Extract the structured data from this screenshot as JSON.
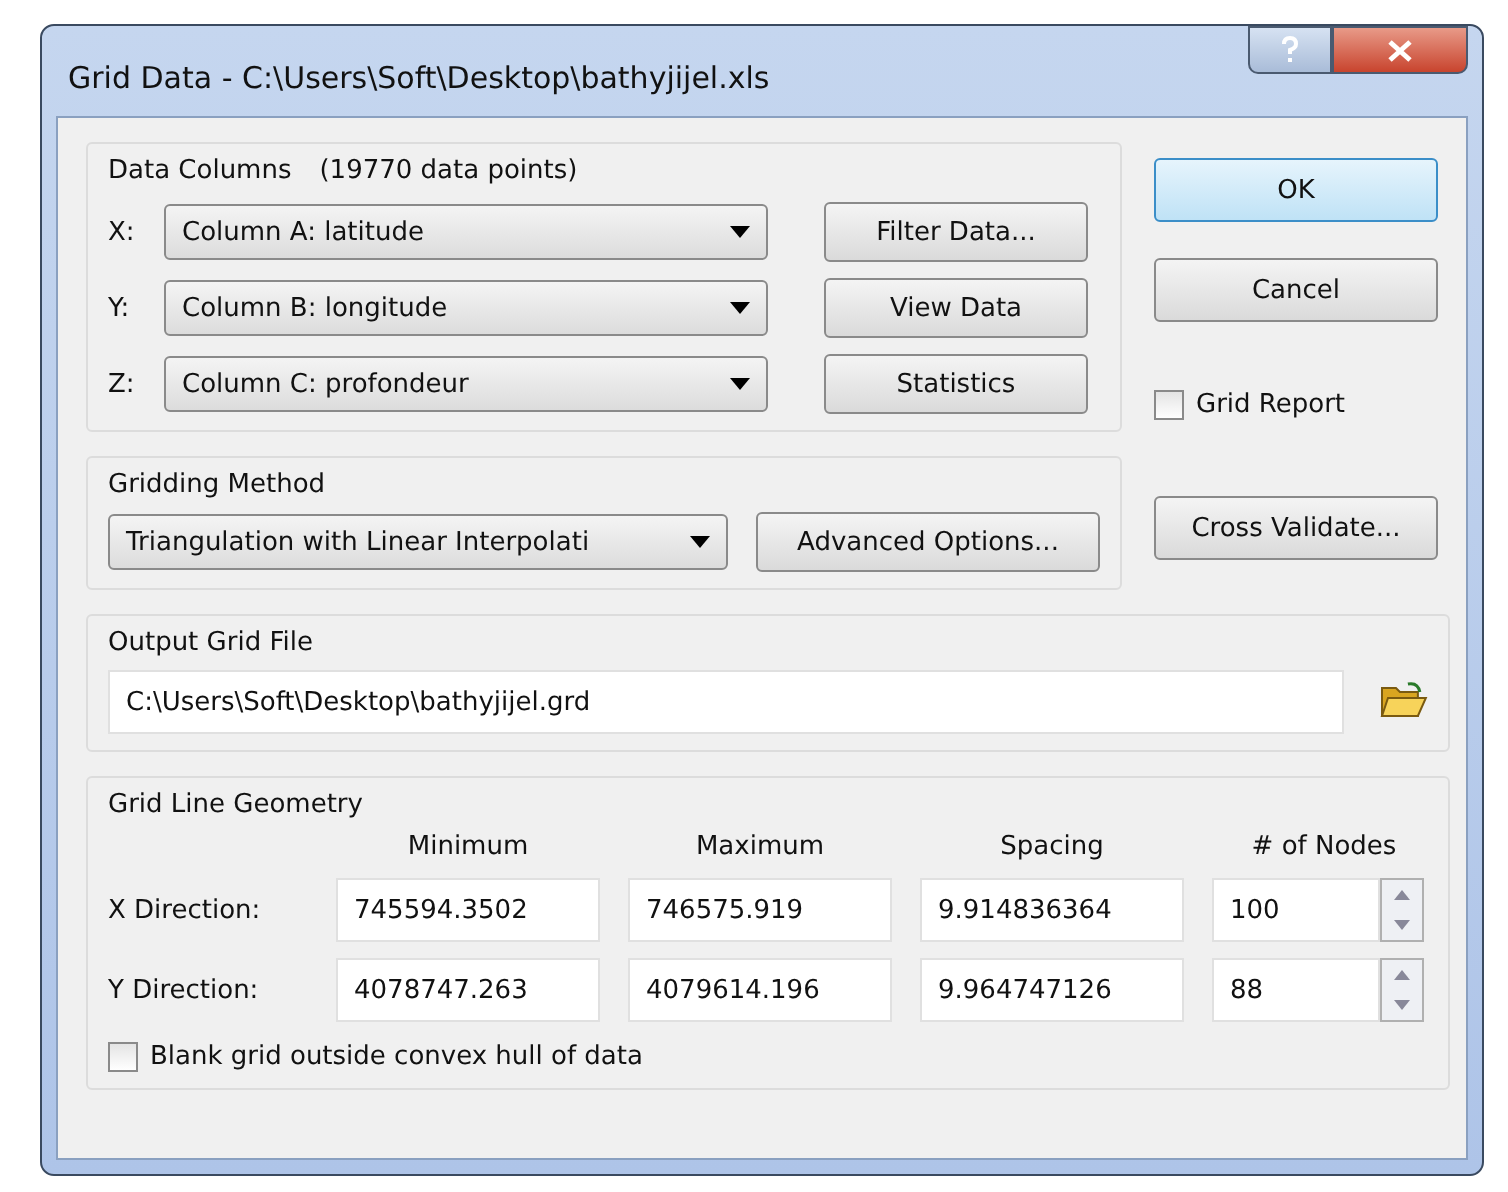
{
  "window": {
    "title": "Grid Data - C:\\Users\\Soft\\Desktop\\bathyjijel.xls"
  },
  "data_columns": {
    "title": "Data Columns",
    "count": "(19770 data points)",
    "rows": [
      {
        "axis": "X:",
        "value": "Column A:  latitude",
        "button": "Filter Data..."
      },
      {
        "axis": "Y:",
        "value": "Column B:  longitude",
        "button": "View Data"
      },
      {
        "axis": "Z:",
        "value": "Column C:  profondeur",
        "button": "Statistics"
      }
    ]
  },
  "dialog_buttons": [
    {
      "label": "OK",
      "default": true
    },
    {
      "label": "Cancel",
      "default": false
    }
  ],
  "grid_report": {
    "label": "Grid Report",
    "checked": false
  },
  "gridding_method": {
    "title": "Gridding Method",
    "value": "Triangulation with Linear Interpolati",
    "options_button": "Advanced Options...",
    "cross_validate": "Cross Validate..."
  },
  "output_grid_file": {
    "title": "Output Grid File",
    "value": "C:\\Users\\Soft\\Desktop\\bathyjijel.grd"
  },
  "grid_line_geometry": {
    "title": "Grid Line Geometry",
    "columns": [
      "Minimum",
      "Maximum",
      "Spacing",
      "# of Nodes"
    ],
    "rows": [
      {
        "label": "X Direction:",
        "values": [
          "745594.3502",
          "746575.919",
          "9.914836364",
          "100"
        ]
      },
      {
        "label": "Y Direction:",
        "values": [
          "4078747.263",
          "4079614.196",
          "9.964747126",
          "88"
        ]
      }
    ],
    "blank": {
      "label": "Blank grid outside convex hull of data",
      "checked": false
    }
  }
}
